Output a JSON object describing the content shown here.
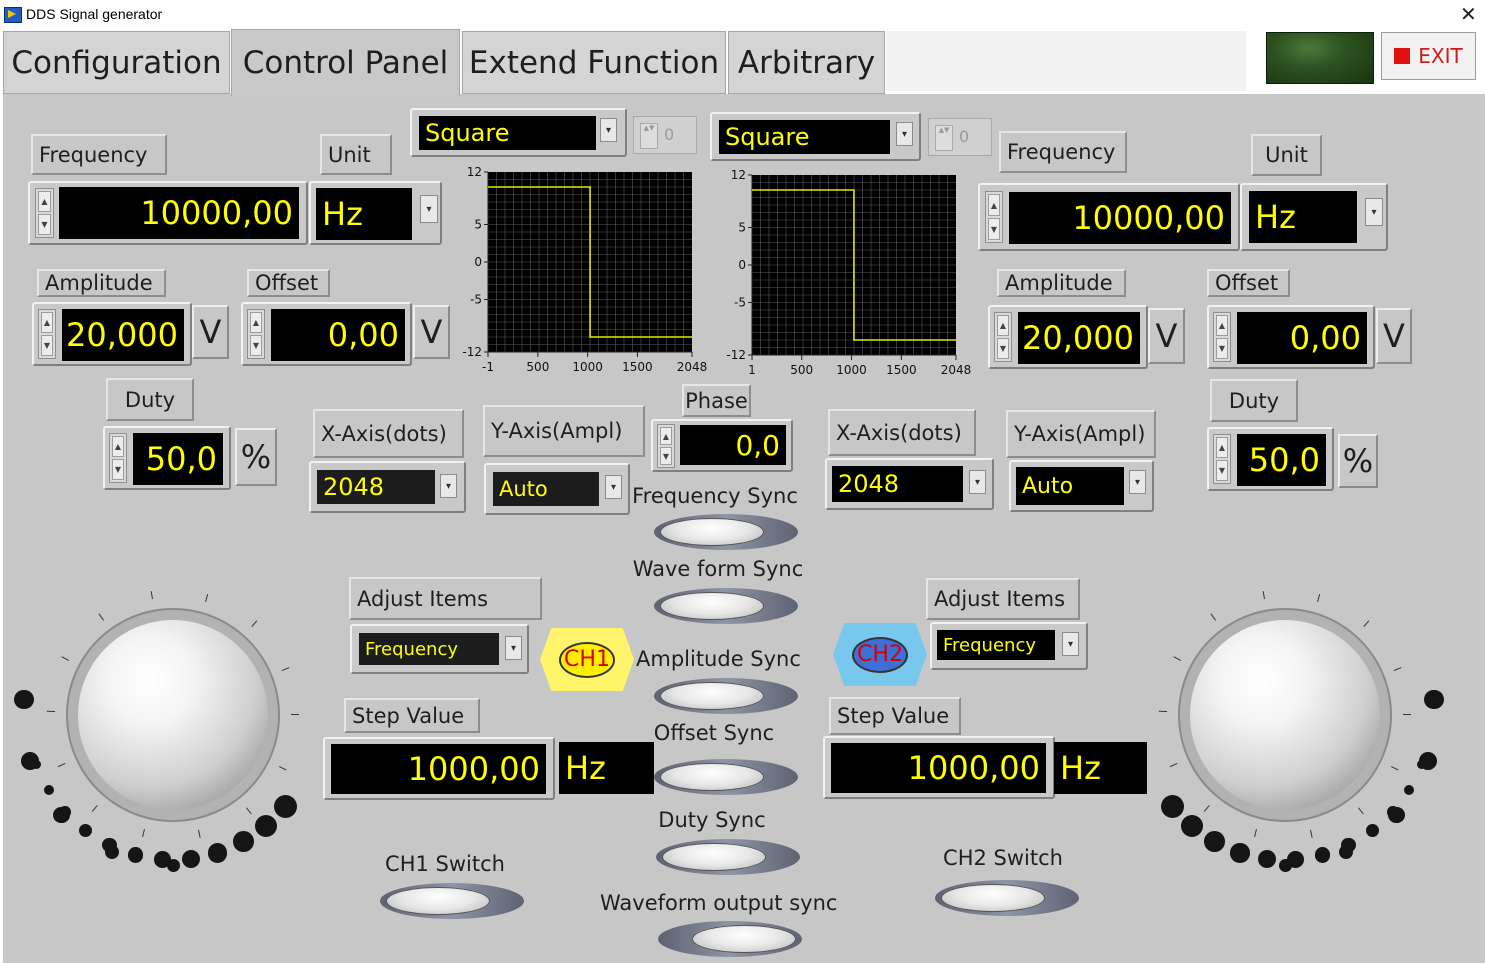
{
  "window": {
    "title": "DDS Signal generator",
    "close_glyph": "✕"
  },
  "tabs": [
    "Configuration",
    "Control Panel",
    "Extend Function",
    "Arbitrary"
  ],
  "exit_label": "EXIT",
  "ch1": {
    "waveform": "Square",
    "waveform_index": "0",
    "frequency_label": "Frequency",
    "frequency_value": "10000,00",
    "unit_label": "Unit",
    "unit_value": "Hz",
    "amplitude_label": "Amplitude",
    "amplitude_value": "20,000",
    "amplitude_unit": "V",
    "offset_label": "Offset",
    "offset_value": "0,00",
    "offset_unit": "V",
    "duty_label": "Duty",
    "duty_value": "50,0",
    "duty_unit": "%",
    "xaxis_label": "X-Axis(dots)",
    "xaxis_value": "2048",
    "yaxis_label": "Y-Axis(Ampl)",
    "yaxis_value": "Auto",
    "adjust_label": "Adjust Items",
    "adjust_value": "Frequency",
    "badge": "CH1",
    "step_label": "Step Value",
    "step_value": "1000,00",
    "step_unit": "Hz",
    "switch_label": "CH1 Switch"
  },
  "ch2": {
    "waveform": "Square",
    "waveform_index": "0",
    "frequency_label": "Frequency",
    "frequency_value": "10000,00",
    "unit_label": "Unit",
    "unit_value": "Hz",
    "amplitude_label": "Amplitude",
    "amplitude_value": "20,000",
    "amplitude_unit": "V",
    "offset_label": "Offset",
    "offset_value": "0,00",
    "offset_unit": "V",
    "duty_label": "Duty",
    "duty_value": "50,0",
    "duty_unit": "%",
    "xaxis_label": "X-Axis(dots)",
    "xaxis_value": "2048",
    "yaxis_label": "Y-Axis(Ampl)",
    "yaxis_value": "Auto",
    "adjust_label": "Adjust Items",
    "adjust_value": "Frequency",
    "badge": "CH2",
    "step_label": "Step Value",
    "step_value": "1000,00",
    "step_unit": "Hz",
    "switch_label": "CH2 Switch"
  },
  "phase": {
    "label": "Phase",
    "value": "0,0"
  },
  "sync": {
    "frequency": "Frequency Sync",
    "waveform": "Wave form Sync",
    "amplitude": "Amplitude Sync",
    "offset": "Offset Sync",
    "duty": "Duty Sync",
    "output": "Waveform output sync"
  },
  "colors": {
    "display_bg": "#000000",
    "display_text": "#ffff00",
    "panel": "#c7c7c7",
    "ch1_badge": "#ffff66",
    "ch2_badge": "#66bbee"
  },
  "chart_data": [
    {
      "type": "line",
      "title": "",
      "xlabel": "",
      "ylabel": "",
      "x_ticks": [
        "-1",
        "500",
        "1000",
        "1500",
        "2048"
      ],
      "y_ticks": [
        "12",
        "5",
        "0",
        "-5",
        "-12"
      ],
      "xlim": [
        -1,
        2048
      ],
      "ylim": [
        -12,
        12
      ],
      "grid": true,
      "series": [
        {
          "x": [
            0,
            1024,
            1024,
            2048
          ],
          "y": [
            10,
            10,
            -10,
            -10
          ]
        }
      ]
    },
    {
      "type": "line",
      "title": "",
      "xlabel": "",
      "ylabel": "",
      "x_ticks": [
        "1",
        "500",
        "1000",
        "1500",
        "2048"
      ],
      "y_ticks": [
        "12",
        "5",
        "0",
        "-5",
        "-12"
      ],
      "xlim": [
        1,
        2048
      ],
      "ylim": [
        -12,
        12
      ],
      "grid": true,
      "series": [
        {
          "x": [
            1,
            1024,
            1024,
            2048
          ],
          "y": [
            10,
            10,
            -10,
            -10
          ]
        }
      ]
    }
  ]
}
